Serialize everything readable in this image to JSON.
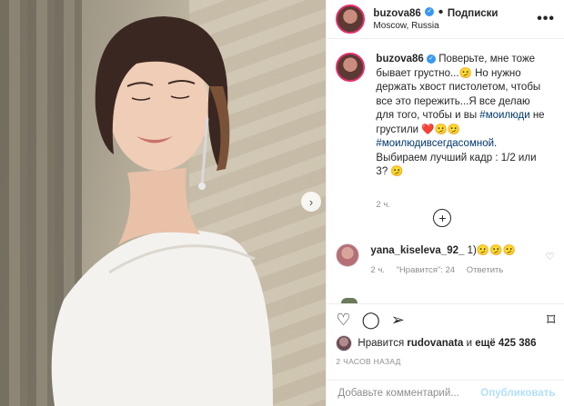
{
  "header": {
    "username": "buzova86",
    "separator": "•",
    "follow_label": "Подписки",
    "location": "Moscow, Russia",
    "more_label": "•••"
  },
  "caption": {
    "username": "buzova86",
    "text_1": " Поверьте, мне тоже бывает грустно...🫤 Но нужно держать хвост пистолетом, чтобы все это пережить...Я все делаю для того, чтобы и вы ",
    "hashtag_1": "#моилюди",
    "text_2": " не грустили ❤️🫤🫤 ",
    "hashtag_2": "#моилюдивсегдасомной",
    "text_3": ". Выбираем лучший кадр : 1/2 или 3? 🫤",
    "time": "2 ч."
  },
  "load_more_label": "+",
  "comment": {
    "username": "yana_kiseleva_92_",
    "text": " 1)🫤🫤🫤",
    "time": "2 ч.",
    "likes": "\"Нравится\": 24",
    "reply": "Ответить"
  },
  "actions": {
    "like_icon": "♡",
    "comment_icon": "◯",
    "share_icon": "➢",
    "bookmark_icon": "⌑"
  },
  "likes": {
    "prefix": "Нравится ",
    "user": "rudovanata",
    "middle": " и ",
    "count": "ещё 425 386"
  },
  "ago": "2 ЧАСОВ НАЗАД",
  "add_comment": {
    "placeholder": "Добавьте комментарий...",
    "publish_label": "Опубликовать"
  },
  "photo": {
    "next_arrow": "›"
  },
  "colors": {
    "verified": "#3897f0",
    "link": "#00376b",
    "publish_disabled": "#b2dffc"
  }
}
